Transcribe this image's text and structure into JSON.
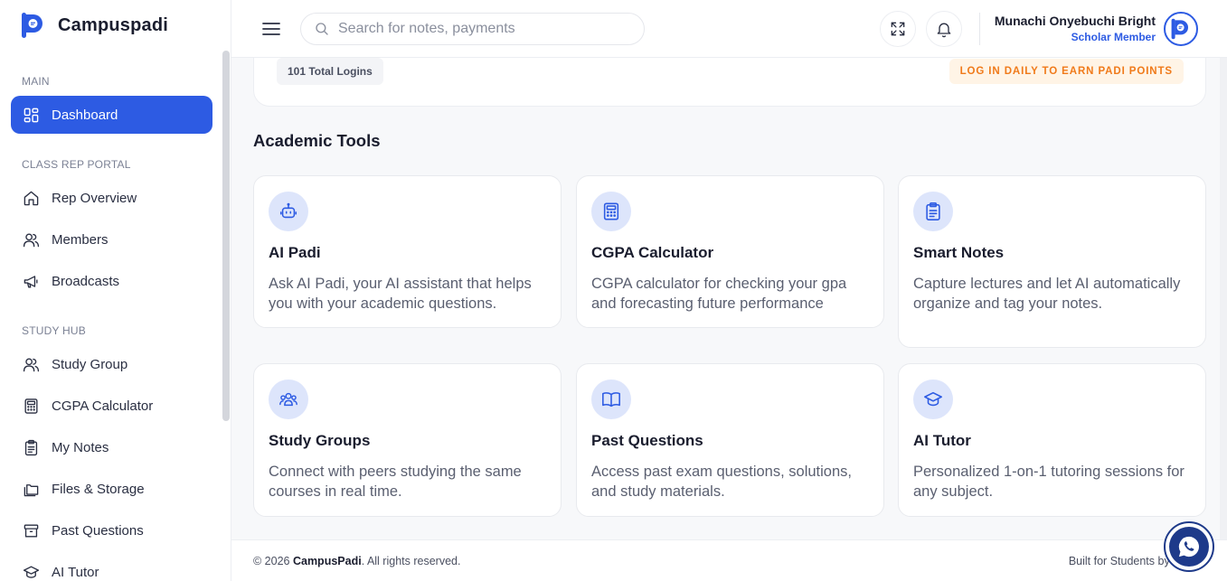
{
  "brand": {
    "name": "Campuspadi",
    "logo_icon": "campuspadi-logo-icon"
  },
  "sidebar": {
    "sections": [
      {
        "label": "MAIN"
      },
      {
        "label": "CLASS REP PORTAL"
      },
      {
        "label": "STUDY HUB"
      }
    ],
    "items": [
      {
        "label": "Dashboard",
        "icon": "dashboard-grid-icon",
        "active": true
      },
      {
        "label": "Rep Overview",
        "icon": "home-icon"
      },
      {
        "label": "Members",
        "icon": "users-icon"
      },
      {
        "label": "Broadcasts",
        "icon": "megaphone-icon"
      },
      {
        "label": "Study Group",
        "icon": "users-icon"
      },
      {
        "label": "CGPA Calculator",
        "icon": "calculator-icon"
      },
      {
        "label": "My Notes",
        "icon": "clipboard-icon"
      },
      {
        "label": "Files & Storage",
        "icon": "folders-icon"
      },
      {
        "label": "Past Questions",
        "icon": "archive-icon"
      },
      {
        "label": "AI Tutor",
        "icon": "graduation-cap-icon"
      }
    ]
  },
  "header": {
    "search_placeholder": "Search for notes, payments",
    "search_value": "",
    "user": {
      "name": "Munachi Onyebuchi Bright",
      "role": "Scholar Member"
    }
  },
  "login_card": {
    "total_logins": "101 Total Logins",
    "daily_prompt": "LOG IN DAILY TO EARN PADI POINTS"
  },
  "academic_tools": {
    "title": "Academic Tools",
    "tools": [
      {
        "title": "AI Padi",
        "description": "Ask AI Padi, your AI assistant that helps you with your academic questions.",
        "icon": "robot-icon"
      },
      {
        "title": "CGPA Calculator",
        "description": "CGPA calculator for checking your gpa and forecasting future performance",
        "icon": "calculator-icon"
      },
      {
        "title": "Smart Notes",
        "description": "Capture lectures and let AI automatically organize and tag your notes.",
        "icon": "clipboard-list-icon"
      },
      {
        "title": "Study Groups",
        "description": "Connect with peers studying the same courses in real time.",
        "icon": "users-group-icon"
      },
      {
        "title": "Past Questions",
        "description": "Access past exam questions, solutions, and study materials.",
        "icon": "open-book-icon"
      },
      {
        "title": "AI Tutor",
        "description": "Personalized 1-on-1 tutoring sessions for any subject.",
        "icon": "graduation-cap-icon"
      }
    ]
  },
  "footer": {
    "copyright_prefix": "© 2026 ",
    "copyright_brand": "CampusPadi",
    "copyright_suffix": ". All rights reserved.",
    "built_for": "Built for Students by St"
  },
  "colors": {
    "accent": "#2d5be3",
    "whatsapp": "#1e3a8a",
    "warning": "#f07a1a"
  }
}
